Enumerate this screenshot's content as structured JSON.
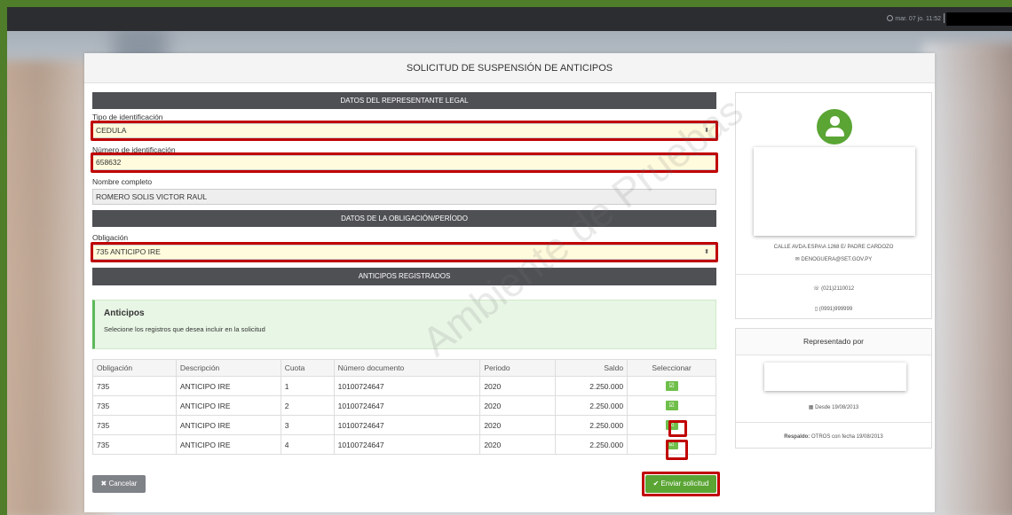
{
  "topbar": {
    "clock": "mar. 07 jo. 11:52"
  },
  "page": {
    "title": "SOLICITUD DE SUSPENSIÓN DE ANTICIPOS"
  },
  "sections": {
    "representante": "DATOS DEL REPRESENTANTE LEGAL",
    "obligacion": "DATOS DE LA OBLIGACIÓN/PERÍODO",
    "anticipos": "ANTICIPOS REGISTRADOS"
  },
  "form": {
    "tipo_label": "Tipo de identificación",
    "tipo_value": "CEDULA",
    "numero_label": "Número de identificación",
    "numero_value": "658632",
    "nombre_label": "Nombre completo",
    "nombre_value": "ROMERO SOLIS VICTOR RAUL",
    "obligacion_label": "Obligación",
    "obligacion_value": "735 ANTICIPO IRE",
    "caret": "⬍"
  },
  "alert": {
    "title": "Anticipos",
    "message": "Selecione los registros que desea incluir en la solicitud"
  },
  "table": {
    "headers": [
      "Obligación",
      "Descripción",
      "Cuota",
      "Número documento",
      "Periodo",
      "Saldo",
      "Seleccionar"
    ],
    "rows": [
      [
        "735",
        "ANTICIPO IRE",
        "1",
        "10100724647",
        "2020",
        "2.250.000"
      ],
      [
        "735",
        "ANTICIPO IRE",
        "2",
        "10100724647",
        "2020",
        "2.250.000"
      ],
      [
        "735",
        "ANTICIPO IRE",
        "3",
        "10100724647",
        "2020",
        "2.250.000"
      ],
      [
        "735",
        "ANTICIPO IRE",
        "4",
        "10100724647",
        "2020",
        "2.250.000"
      ]
    ],
    "check_glyph": "☑"
  },
  "buttons": {
    "cancel": "✖ Cancelar",
    "send": "✔ Enviar solicitud"
  },
  "sidebar": {
    "address": "CALLE AVDA.ESPA\\A 1268 E/ PADRE CARDOZO",
    "email": "✉ DENOGUERA@SET.GOV.PY",
    "phone": "☏ (021)2110012",
    "mobile": "▯ (0991)999999",
    "rep_title": "Representado por",
    "since": "▦ Desde 19/08/2013",
    "respaldo_label": "Respaldo:",
    "respaldo_text": "OTROS con fecha 19/08/2013"
  },
  "watermark": "Ambiente de Pruebas",
  "colors": {
    "accent_green": "#5aa534",
    "highlight_red": "#c00000",
    "section_bar": "#4f5054"
  }
}
